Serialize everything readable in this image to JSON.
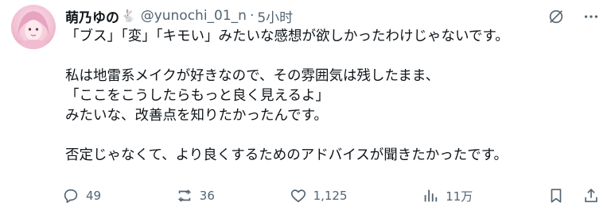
{
  "post": {
    "author_name": "萌乃ゆの",
    "author_emoji": "🐇",
    "handle": "@yunochi_01_n",
    "separator": "·",
    "time": "5小时",
    "lines": [
      "「ブス」「変」「キモい」みたいな感想が欲しかったわけじゃないです。",
      "",
      "私は地雷系メイクが好きなので、その雰囲気は残したまま、",
      "「ここをこうしたらもっと良く見えるよ」",
      "みたいな、改善点を知りたかったんです。",
      "",
      "否定じゃなくて、より良くするためのアドバイスが聞きたかったです。"
    ]
  },
  "stats": {
    "replies": "49",
    "reposts": "36",
    "likes": "1,125",
    "views": "11万"
  },
  "colors": {
    "text": "#0f1419",
    "muted": "#536471",
    "background": "#ffffff"
  },
  "icons": [
    "avatar-image",
    "grok-icon",
    "more-icon",
    "reply-icon",
    "repost-icon",
    "like-icon",
    "views-icon",
    "bookmark-icon",
    "share-icon"
  ]
}
